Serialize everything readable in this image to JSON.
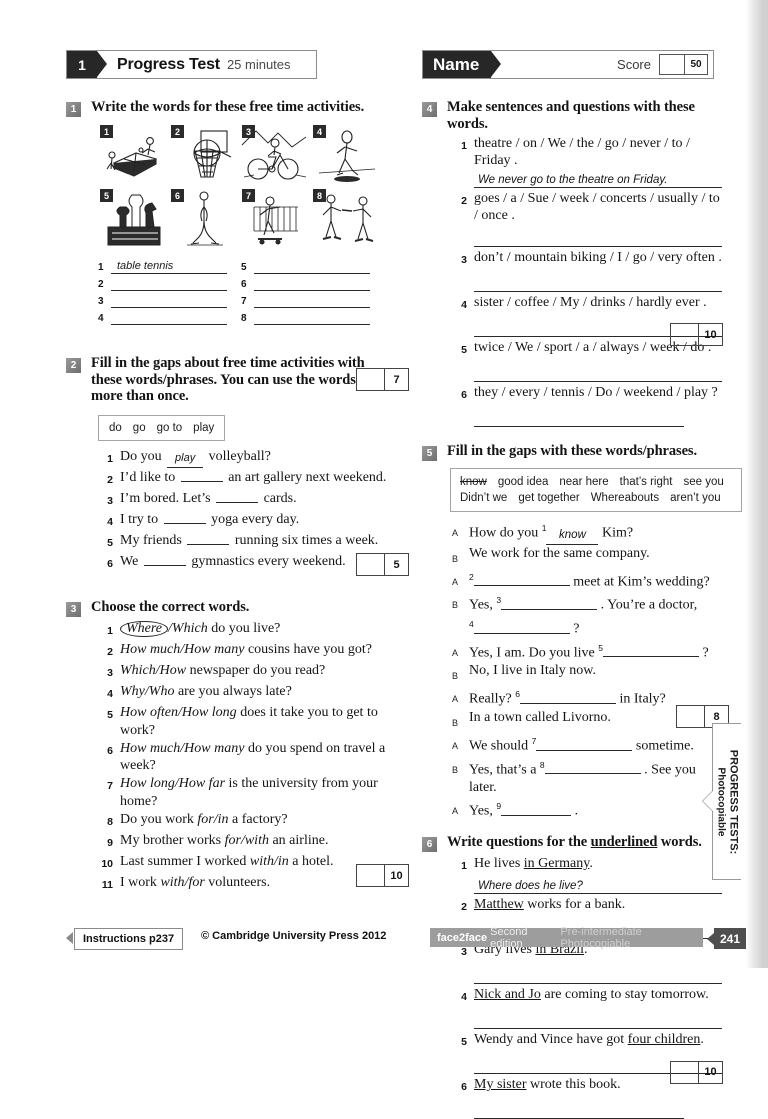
{
  "header": {
    "left_badge": "1",
    "title": "Progress Test",
    "duration": "25 minutes",
    "name_label": "Name",
    "score_label": "Score",
    "score_total": "50"
  },
  "ex1": {
    "num": "1",
    "title": "Write the words for these free time activities.",
    "pictures": [
      {
        "n": "1",
        "icon": "table-tennis-icon"
      },
      {
        "n": "2",
        "icon": "basketball-icon"
      },
      {
        "n": "3",
        "icon": "cycling-icon"
      },
      {
        "n": "4",
        "icon": "running-icon"
      },
      {
        "n": "5",
        "icon": "chess-icon"
      },
      {
        "n": "6",
        "icon": "yoga-icon"
      },
      {
        "n": "7",
        "icon": "skateboarding-icon"
      },
      {
        "n": "8",
        "icon": "martial-arts-icon"
      }
    ],
    "answers_left": [
      {
        "n": "1",
        "answer": "table tennis"
      },
      {
        "n": "2",
        "answer": ""
      },
      {
        "n": "3",
        "answer": ""
      },
      {
        "n": "4",
        "answer": ""
      }
    ],
    "answers_right": [
      {
        "n": "5",
        "answer": ""
      },
      {
        "n": "6",
        "answer": ""
      },
      {
        "n": "7",
        "answer": ""
      },
      {
        "n": "8",
        "answer": ""
      }
    ],
    "marks": "7"
  },
  "ex2": {
    "num": "2",
    "title": "Fill in the gaps about free time activities with these words/phrases. You can use the words more than once.",
    "wordbank": [
      "do",
      "go",
      "go to",
      "play"
    ],
    "items": [
      {
        "n": "1",
        "pre": "Do you",
        "answer": "play",
        "post": "volleyball?"
      },
      {
        "n": "2",
        "pre": "I’d like to",
        "answer": "",
        "post": "an art gallery next weekend."
      },
      {
        "n": "3",
        "pre": "I’m bored. Let’s",
        "answer": "",
        "post": "cards."
      },
      {
        "n": "4",
        "pre": "I try to",
        "answer": "",
        "post": "yoga every day."
      },
      {
        "n": "5",
        "pre": "My friends",
        "answer": "",
        "post": "running six times a week."
      },
      {
        "n": "6",
        "pre": "We",
        "answer": "",
        "post": "gymnastics every weekend."
      }
    ],
    "marks": "5"
  },
  "ex3": {
    "num": "3",
    "title": "Choose the correct words.",
    "items": [
      {
        "n": "1",
        "opt_a": "Where",
        "opt_b": "Which",
        "circled": "a",
        "rest": "do you live?"
      },
      {
        "n": "2",
        "opt_a": "How much",
        "opt_b": "How many",
        "circled": "",
        "rest": "cousins have you got?"
      },
      {
        "n": "3",
        "opt_a": "Which",
        "opt_b": "How",
        "circled": "",
        "rest": "newspaper do you read?"
      },
      {
        "n": "4",
        "opt_a": "Why",
        "opt_b": "Who",
        "circled": "",
        "rest": "are you always late?"
      },
      {
        "n": "5",
        "opt_a": "How often",
        "opt_b": "How long",
        "circled": "",
        "rest": "does it take you to get to work?"
      },
      {
        "n": "6",
        "opt_a": "How much",
        "opt_b": "How many",
        "circled": "",
        "rest": "do you spend on travel a week?"
      },
      {
        "n": "7",
        "opt_a": "How long",
        "opt_b": "How far",
        "circled": "",
        "rest": "is the university from your home?"
      },
      {
        "n": "8",
        "pre": "Do you work",
        "opt_a": "for",
        "opt_b": "in",
        "circled": "",
        "rest": "a factory?"
      },
      {
        "n": "9",
        "pre": "My brother works",
        "opt_a": "for",
        "opt_b": "with",
        "circled": "",
        "rest": "an airline."
      },
      {
        "n": "10",
        "pre": "Last summer I worked",
        "opt_a": "with",
        "opt_b": "in",
        "circled": "",
        "rest": "a hotel."
      },
      {
        "n": "11",
        "pre": "I work",
        "opt_a": "with",
        "opt_b": "for",
        "circled": "",
        "rest": "volunteers."
      }
    ],
    "marks": "10"
  },
  "ex4": {
    "num": "4",
    "title": "Make sentences and questions with these words.",
    "items": [
      {
        "n": "1",
        "prompt": "theatre / on / We / the / go / never / to / Friday .",
        "answer": "We never go to the theatre on Friday."
      },
      {
        "n": "2",
        "prompt": "goes / a / Sue / week / concerts / usually / to / once .",
        "answer": ""
      },
      {
        "n": "3",
        "prompt": "don’t / mountain biking / I / go / very often .",
        "answer": ""
      },
      {
        "n": "4",
        "prompt": "sister / coffee / My / drinks / hardly ever .",
        "answer": ""
      },
      {
        "n": "5",
        "prompt": "twice / We / sport / a / always / week / do .",
        "answer": ""
      },
      {
        "n": "6",
        "prompt": "they / every / tennis / Do / weekend / play ?",
        "answer": ""
      }
    ],
    "marks": "10"
  },
  "ex5": {
    "num": "5",
    "title": "Fill in the gaps with these words/phrases.",
    "wordbank_row1": [
      "know",
      "good idea",
      "near here",
      "that’s right",
      "see you"
    ],
    "wordbank_row2": [
      "Didn’t we",
      "get together",
      "Whereabouts",
      "aren’t you"
    ],
    "wordbank_strike": "know",
    "lines": [
      {
        "spk": "A",
        "pre": "How do you",
        "sup": "1",
        "answer": "know",
        "post": "Kim?"
      },
      {
        "spk": "B",
        "pre": "We work for the same company.",
        "sup": "",
        "answer": "",
        "post": ""
      },
      {
        "spk": "A",
        "pre": "",
        "sup": "2",
        "answer": "",
        "post": "meet at Kim’s wedding?"
      },
      {
        "spk": "B",
        "pre": "Yes,",
        "sup": "3",
        "answer": "",
        "post": ". You’re a doctor,"
      },
      {
        "spk": "",
        "pre": "",
        "sup": "4",
        "answer": "",
        "post": "?"
      },
      {
        "spk": "A",
        "pre": "Yes, I am. Do you live",
        "sup": "5",
        "answer": "",
        "post": "?"
      },
      {
        "spk": "B",
        "pre": "No, I live in Italy now.",
        "sup": "",
        "answer": "",
        "post": ""
      },
      {
        "spk": "A",
        "pre": "Really?",
        "sup": "6",
        "answer": "",
        "post": "in Italy?"
      },
      {
        "spk": "B",
        "pre": "In a town called Livorno.",
        "sup": "",
        "answer": "",
        "post": ""
      },
      {
        "spk": "A",
        "pre": "We should",
        "sup": "7",
        "answer": "",
        "post": "sometime."
      },
      {
        "spk": "B",
        "pre": "Yes, that’s a",
        "sup": "8",
        "answer": "",
        "post": ". See you later."
      },
      {
        "spk": "A",
        "pre": "Yes,",
        "sup": "9",
        "answer": "",
        "post": "."
      }
    ],
    "marks": "8"
  },
  "ex6": {
    "num": "6",
    "title_pre": "Write questions for the ",
    "title_u": "underlined",
    "title_post": " words.",
    "items": [
      {
        "n": "1",
        "pre": "He lives ",
        "u": "in Germany",
        "post": ".",
        "answer": "Where does he live?"
      },
      {
        "n": "2",
        "pre": "",
        "u": "Matthew",
        "post": " works for a bank.",
        "answer": ""
      },
      {
        "n": "3",
        "pre": "Gary lives ",
        "u": "in Brazil",
        "post": ".",
        "answer": ""
      },
      {
        "n": "4",
        "pre": "",
        "u": "Nick and Jo",
        "post": " are coming to stay tomorrow.",
        "answer": ""
      },
      {
        "n": "5",
        "pre": "Wendy and Vince have got ",
        "u": "four children",
        "post": ".",
        "answer": ""
      },
      {
        "n": "6",
        "pre": "",
        "u": "My sister",
        "post": " wrote this book.",
        "answer": ""
      }
    ],
    "marks": "10"
  },
  "sidetab": {
    "line1": "PROGRESS TESTS:",
    "line2": "Photocopiable"
  },
  "footer": {
    "instructions": "Instructions p237",
    "copyright": "© Cambridge University Press 2012",
    "brand": "face2face",
    "edition": "Second edition",
    "level": "Pre-intermediate Photocopiable",
    "page": "241"
  }
}
